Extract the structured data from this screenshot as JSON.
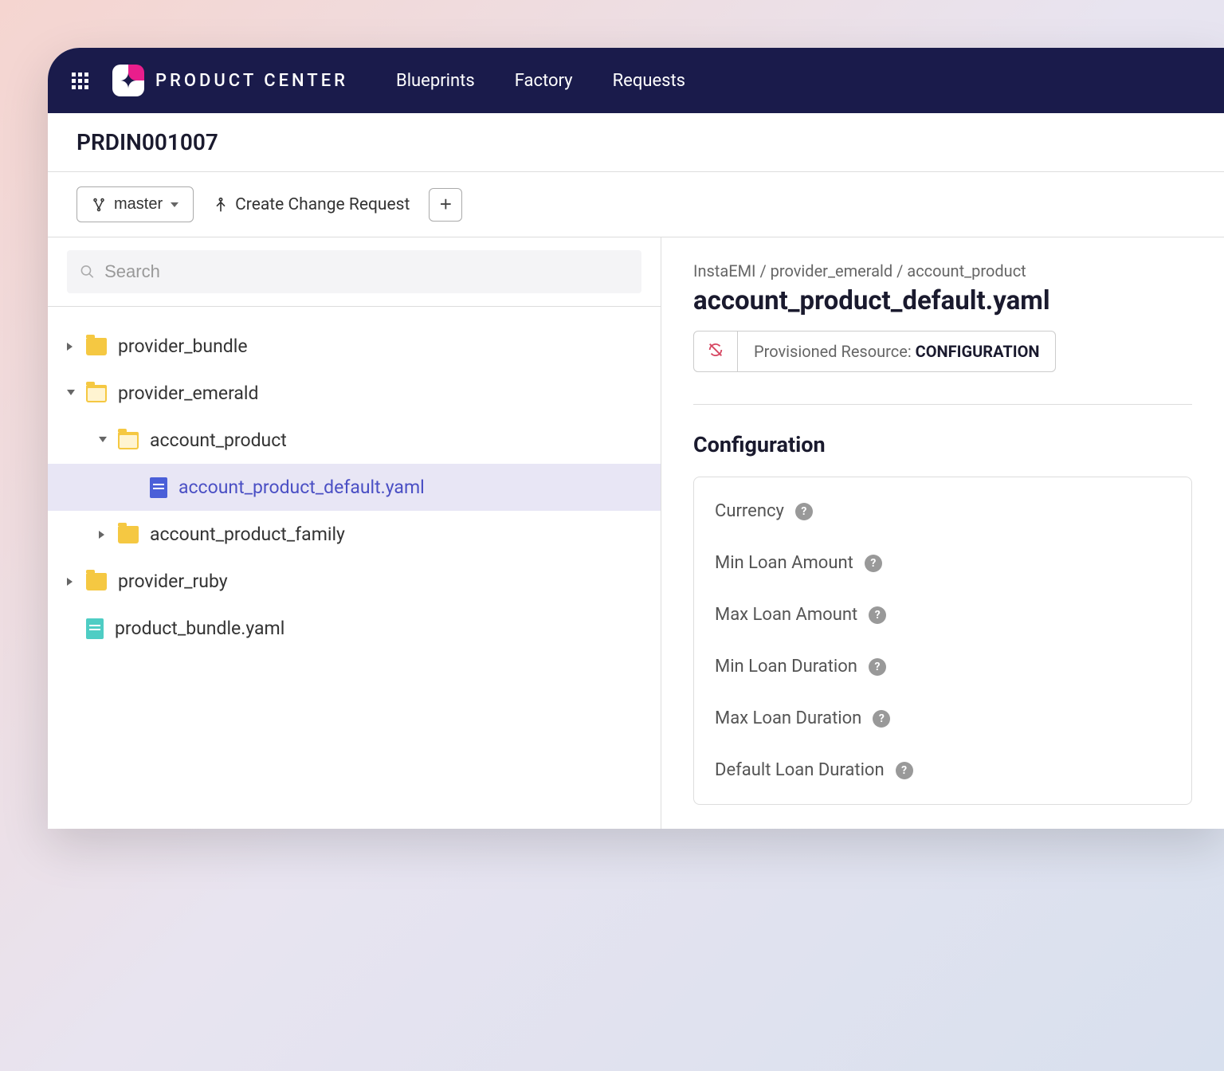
{
  "header": {
    "brand": "PRODUCT CENTER",
    "nav": [
      "Blueprints",
      "Factory",
      "Requests"
    ]
  },
  "project": {
    "id": "PRDIN001007"
  },
  "toolbar": {
    "branch": "master",
    "change_request": "Create Change Request"
  },
  "search": {
    "placeholder": "Search"
  },
  "tree": [
    {
      "label": "provider_bundle",
      "type": "folder",
      "expanded": false,
      "depth": 0
    },
    {
      "label": "provider_emerald",
      "type": "folder",
      "expanded": true,
      "depth": 0
    },
    {
      "label": "account_product",
      "type": "folder",
      "expanded": true,
      "depth": 1
    },
    {
      "label": "account_product_default.yaml",
      "type": "file-blue",
      "depth": 2,
      "selected": true
    },
    {
      "label": "account_product_family",
      "type": "folder",
      "expanded": false,
      "depth": 1
    },
    {
      "label": "provider_ruby",
      "type": "folder",
      "expanded": false,
      "depth": 0
    },
    {
      "label": "product_bundle.yaml",
      "type": "file-teal",
      "depth": 0
    }
  ],
  "content": {
    "breadcrumb": "InstaEMI  /  provider_emerald  /  account_product",
    "title": "account_product_default.yaml",
    "resource_prefix": "Provisioned Resource: ",
    "resource_type": "CONFIGURATION",
    "section_title": "Configuration",
    "fields": [
      "Currency",
      "Min Loan Amount",
      "Max Loan Amount",
      "Min Loan Duration",
      "Max Loan Duration",
      "Default Loan Duration"
    ]
  }
}
